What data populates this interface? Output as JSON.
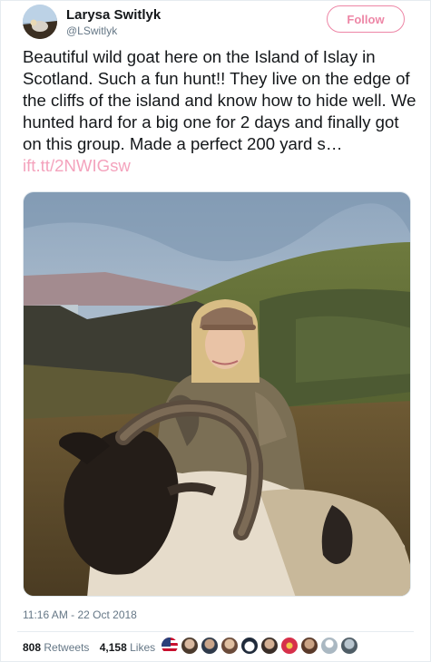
{
  "author": {
    "name": "Larysa Switlyk",
    "handle": "@LSwitlyk"
  },
  "follow_label": "Follow",
  "tweet": {
    "text": "Beautiful wild goat here on the Island of Islay in Scotland. Such a fun hunt!! They live on the edge of the cliffs of the island and know how to hide well.  We hunted hard for a big one for 2 days and finally got on this group. Made a perfect 200 yard s… ",
    "link": "ift.tt/2NWIGsw",
    "timestamp": "11:16 AM - 22 Oct 2018"
  },
  "stats": {
    "retweets_count": "808",
    "retweets_label": "Retweets",
    "likes_count": "4,158",
    "likes_label": "Likes"
  },
  "likers": [
    {
      "icon": "us-flag-avatar"
    },
    {
      "icon": "person-avatar"
    },
    {
      "icon": "person-avatar"
    },
    {
      "icon": "person-avatar"
    },
    {
      "icon": "penguin-avatar"
    },
    {
      "icon": "person-avatar"
    },
    {
      "icon": "flower-avatar"
    },
    {
      "icon": "person-avatar"
    },
    {
      "icon": "default-avatar"
    },
    {
      "icon": "person-avatar"
    }
  ],
  "colors": {
    "follow": "#e0245e",
    "link": "#f4a3bd",
    "meta": "#657786"
  }
}
